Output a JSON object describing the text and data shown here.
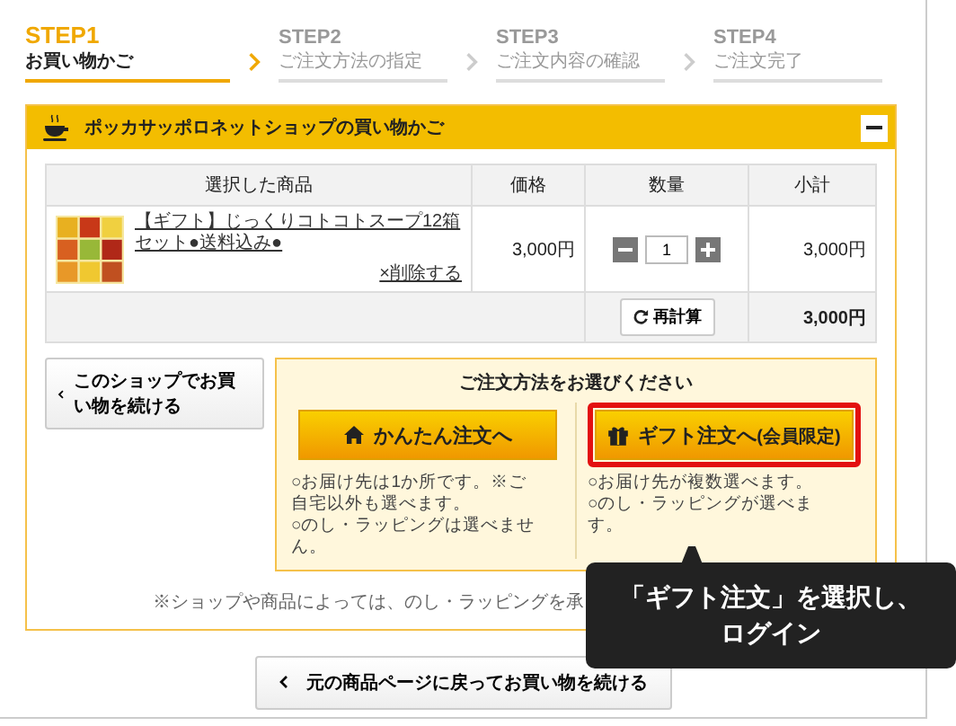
{
  "steps": [
    {
      "step": "STEP1",
      "label": "お買い物かご",
      "selected": true
    },
    {
      "step": "STEP2",
      "label": "ご注文方法の指定",
      "selected": false
    },
    {
      "step": "STEP3",
      "label": "ご注文内容の確認",
      "selected": false
    },
    {
      "step": "STEP4",
      "label": "ご注文完了",
      "selected": false
    }
  ],
  "cart": {
    "title": "ポッカサッポロネットショップの買い物かご",
    "columns": [
      "選択した商品",
      "価格",
      "数量",
      "小計"
    ],
    "items": [
      {
        "name": "【ギフト】じっくりコトコトスープ12箱セット●送料込み●",
        "remove": "×削除する",
        "price": "3,000円",
        "quantity": "1",
        "subtotal": "3,000円"
      }
    ],
    "recalc": "再計算",
    "total": "3,000円"
  },
  "continue_button": "このショップでお買い物を続ける",
  "order": {
    "prompt": "ご注文方法をお選びください",
    "methods": [
      {
        "kind": "home",
        "label": "かんたん注文へ",
        "highlighted": false,
        "notes": [
          "○お届け先は1か所です。※ご自宅以外も選べます。",
          "○のし・ラッピングは選べません。"
        ]
      },
      {
        "kind": "gift",
        "label": "ギフト注文へ",
        "suffix": "(会員限定)",
        "highlighted": true,
        "notes": [
          "○お届け先が複数選べます。",
          "○のし・ラッピングが選べます。"
        ]
      }
    ]
  },
  "note": "※ショップや商品によっては、のし・ラッピングを承",
  "back_button": "元の商品ページに戻ってお買い物を続ける",
  "callout": {
    "lines": [
      "「ギフト注文」を選択し、",
      "ログイン"
    ]
  }
}
